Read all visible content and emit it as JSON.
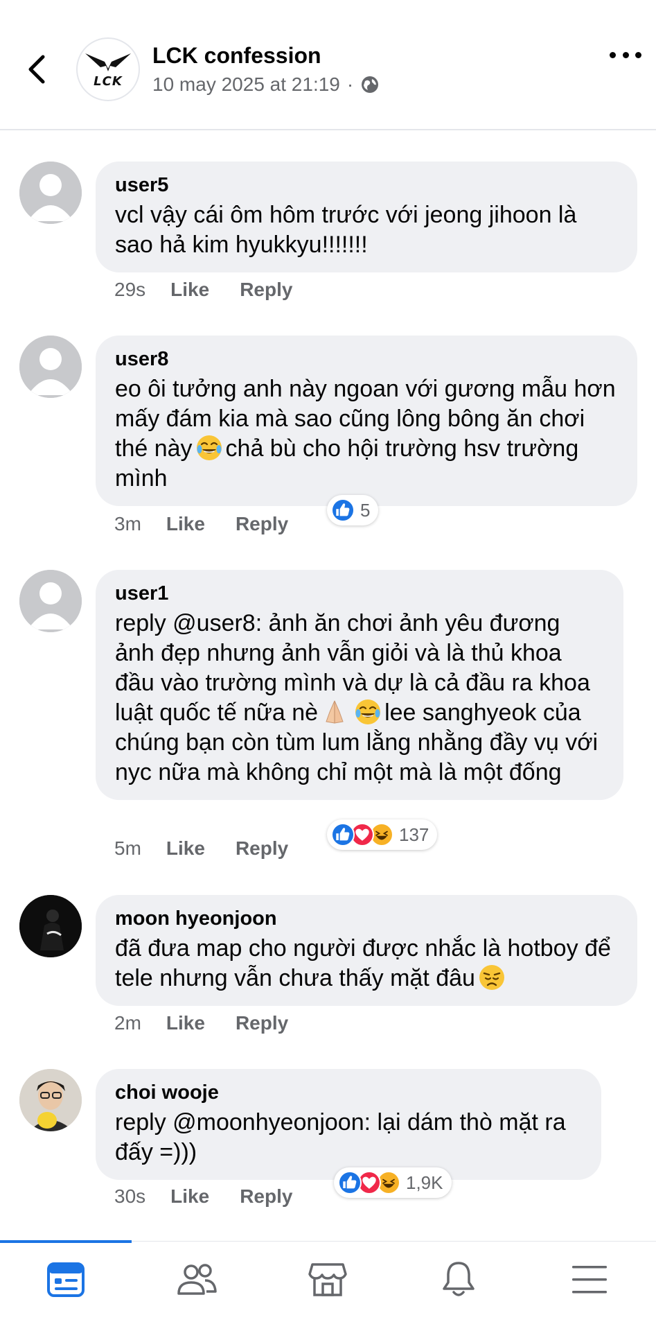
{
  "header": {
    "page_name": "LCK confession",
    "logo_text": "LCK",
    "timestamp": "10 may 2025 at 21:19",
    "separator": "·",
    "privacy_icon": "globe-icon",
    "back_icon": "chevron-left-icon",
    "more_icon": "more-horizontal-icon"
  },
  "actions": {
    "like_label": "Like",
    "reply_label": "Reply"
  },
  "comments": [
    {
      "author": "user5",
      "text": "vcl vậy cái ôm hôm trước với jeong jihoon là sao hả kim hyukkyu!!!!!!!",
      "time": "29s"
    },
    {
      "author": "user8",
      "text_a": "eo ôi tưởng anh này ngoan với gương mẫu hơn mấy đám kia mà sao cũng lông bông ăn chơi thé này",
      "text_b": "chả bù cho hội trường hsv trường mình",
      "time": "3m",
      "reaction_count": "5"
    },
    {
      "author": "user1",
      "text_a": "reply @user8: ảnh ăn chơi ảnh yêu đương ảnh đẹp nhưng ảnh vẫn giỏi và là thủ khoa đầu vào trường mình và dự là cả đầu ra khoa luật quốc tế nữa nè",
      "text_b": "lee sanghyeok của chúng bạn còn tùm lum lằng nhằng đầy vụ với nyc nữa mà không chỉ một mà là một đống",
      "time": "5m",
      "reaction_count": "137"
    },
    {
      "author": "moon hyeonjoon",
      "text": "đã đưa map cho người được nhắc là hotboy để tele nhưng vẫn chưa thấy mặt đâu",
      "time": "2m"
    },
    {
      "author": "choi wooje",
      "text": "reply @moonhyeonjoon: lại dám thò mặt ra đấy =)))",
      "time": "30s",
      "reaction_count": "1,9K"
    }
  ],
  "bottom_nav": {
    "items": [
      "feed-icon",
      "friends-icon",
      "marketplace-icon",
      "notifications-icon",
      "menu-icon"
    ],
    "active": "feed-icon"
  },
  "colors": {
    "accent": "#1b74e4",
    "bubble": "#eff0f3",
    "secondary_text": "#65676b",
    "love": "#f02849",
    "haha": "#f7b125"
  }
}
